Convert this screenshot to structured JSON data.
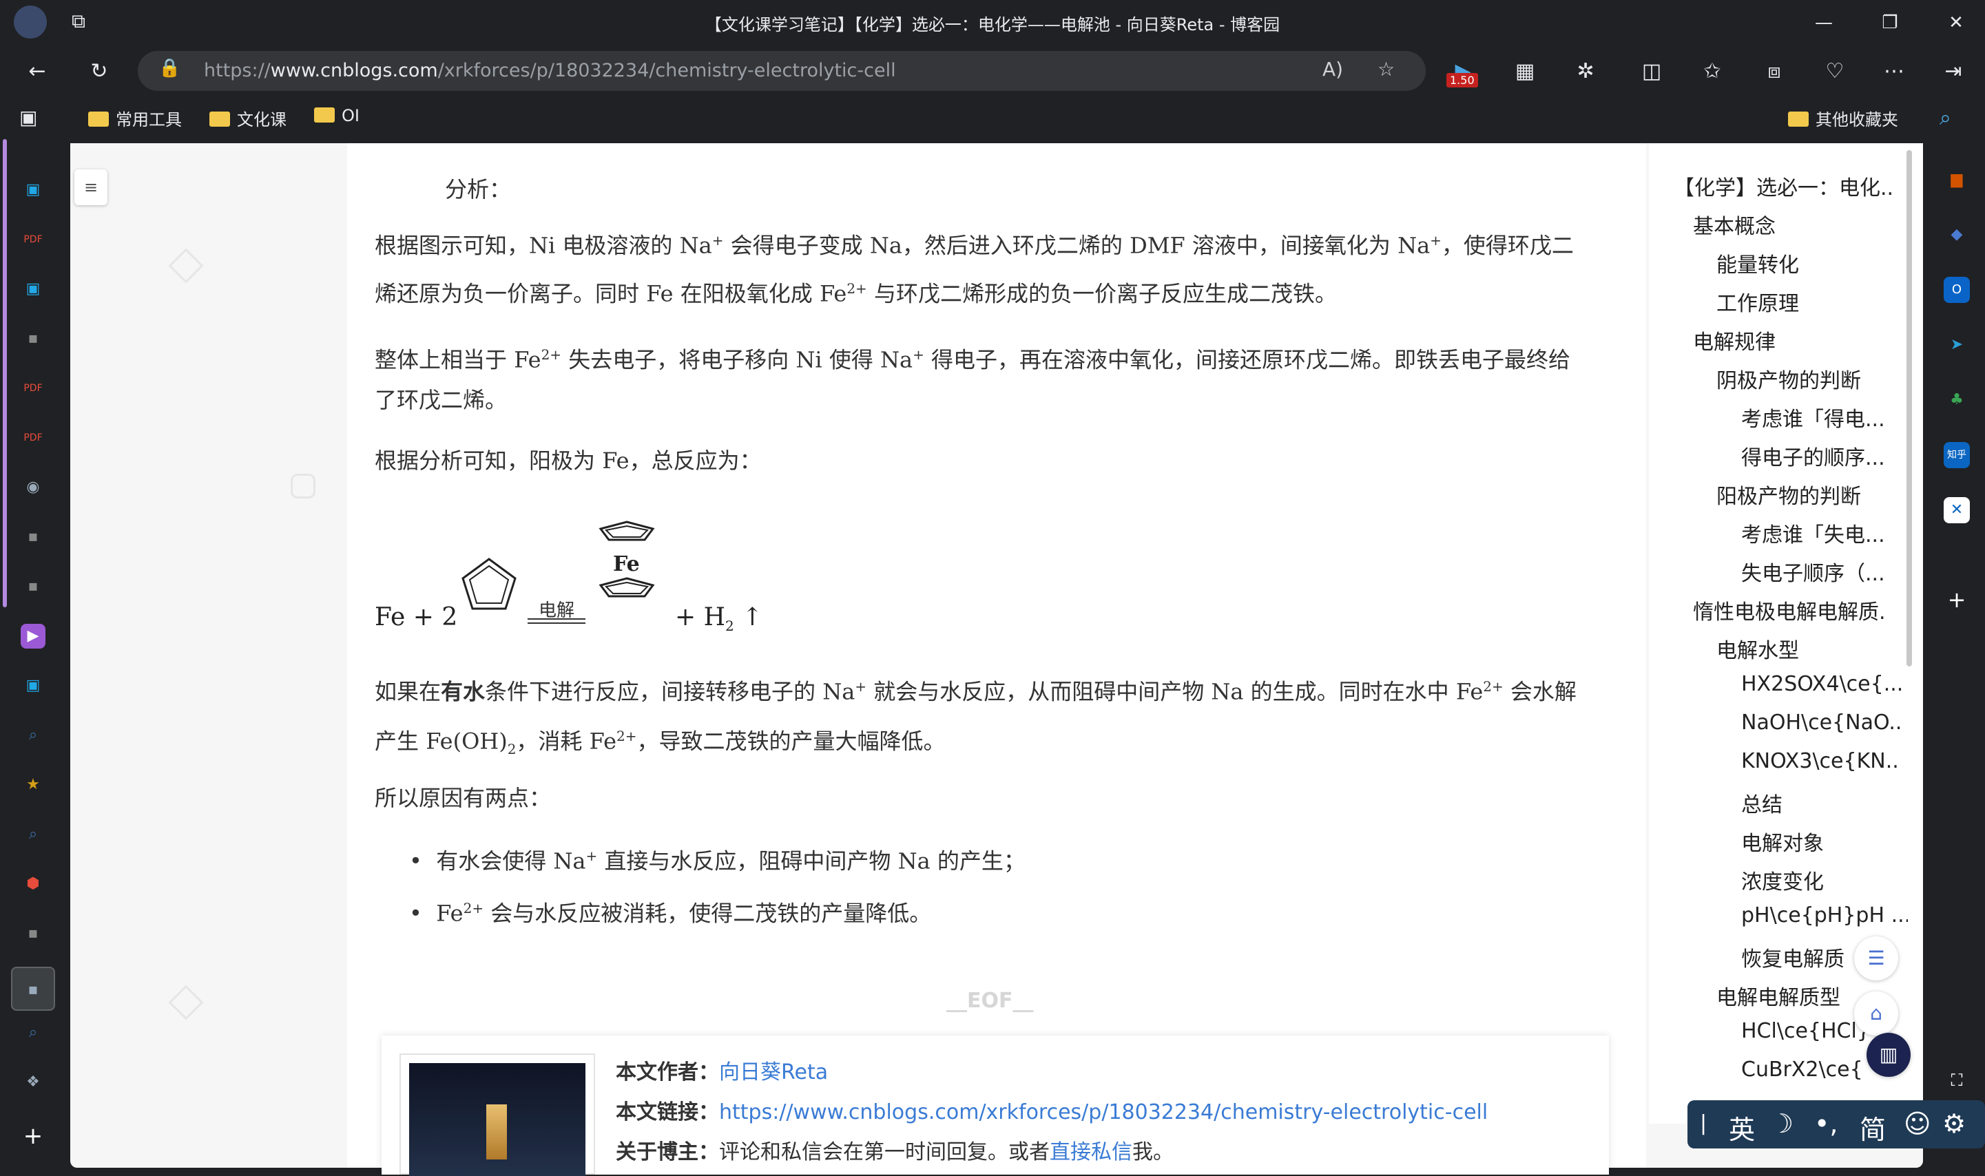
{
  "window": {
    "title": "【文化课学习笔记】【化学】选必一：电化学——电解池 - 向日葵Reta - 博客园"
  },
  "nav": {
    "url_prefix": "https://",
    "url_domain": "www.cnblogs.com",
    "url_path": "/xrkforces/p/18032234/chemistry-electrolytic-cell",
    "badge": "1.50"
  },
  "bookmarks": {
    "items": [
      {
        "label": "常用工具"
      },
      {
        "label": "文化课"
      },
      {
        "label": "OI"
      }
    ],
    "other": "其他收藏夹"
  },
  "article": {
    "p1": "分析：",
    "p2_a": "根据图示可知，",
    "p2_ni": "Ni",
    "p2_b": " 电极溶液的 ",
    "p2_na": "Na",
    "p2_c": " 会得电子变成 ",
    "p2_na2": "Na",
    "p2_d": "，然后进入环戊二烯的 ",
    "p2_dmf": "DMF",
    "p2_e": " 溶液中，间接氧化为 ",
    "p2_na3": "Na",
    "p2_f": "，使得环戊二",
    "p2_line2_a": "烯还原为负一价离子。同时 ",
    "p2_fe": "Fe",
    "p2_line2_b": " 在阳极氧化成 ",
    "p2_fe2": "Fe",
    "p2_line2_c": " 与环戊二烯形成的负一价离子反应生成二茂铁。",
    "p3_a": "整体上相当于 ",
    "p3_fe": "Fe",
    "p3_b": " 失去电子，将电子移向 ",
    "p3_ni": "Ni",
    "p3_c": " 使得 ",
    "p3_na": "Na",
    "p3_d": " 得电子，再在溶液中氧化，间接还原环戊二烯。即铁丢电子最终给",
    "p3_line2": "了环戊二烯。",
    "p4_a": "根据分析可知，阳极为 ",
    "p4_fe": "Fe",
    "p4_b": "，总反应为：",
    "eq_fe": "Fe + 2",
    "eq_cond": "电解",
    "eq_fe_label": "Fe",
    "eq_h2": "+ H",
    "eq_h2_sub": "2",
    "eq_arrow": "↑",
    "p5_a": "如果在",
    "p5_bold": "有水",
    "p5_b": "条件下进行反应，间接转移电子的 ",
    "p5_na": "Na",
    "p5_c": " 就会与水反应，从而阻碍中间产物 ",
    "p5_na2": "Na",
    "p5_d": " 的生成。同时在水中 ",
    "p5_fe": "Fe",
    "p5_e": " 会水解",
    "p5_line2_a": "产生 ",
    "p5_feoh": "Fe(OH)",
    "p5_feoh_sub": "2",
    "p5_line2_b": "，消耗 ",
    "p5_fe2": "Fe",
    "p5_line2_c": "，导致二茂铁的产量大幅降低。",
    "p6": "所以原因有两点：",
    "li1_a": "有水会使得 ",
    "li1_na": "Na",
    "li1_b": " 直接与水反应，阻碍中间产物 ",
    "li1_na2": "Na",
    "li1_c": " 的产生；",
    "li2_fe": "Fe",
    "li2_b": " 会与水反应被消耗，使得二茂铁的产量降低。",
    "sup_plus": "+",
    "sup_2plus": "2+",
    "eof": "__EOF__"
  },
  "author": {
    "author_label": "本文作者：",
    "author_name": "向日葵Reta",
    "link_label": "本文链接：",
    "link": "https://www.cnblogs.com/xrkforces/p/18032234/chemistry-electrolytic-cell",
    "about_label": "关于博主：",
    "about_a": "评论和私信会在第一时间回复。或者",
    "about_link": "直接私信",
    "about_b": "我。"
  },
  "toc": {
    "items": [
      {
        "label": "【化学】选必一：电化.."
      },
      {
        "label": "基本概念"
      },
      {
        "label": "能量转化"
      },
      {
        "label": "工作原理"
      },
      {
        "label": "电解规律"
      },
      {
        "label": "阴极产物的判断"
      },
      {
        "label": "考虑谁「得电..."
      },
      {
        "label": "得电子的顺序..."
      },
      {
        "label": "阳极产物的判断"
      },
      {
        "label": "考虑谁「失电..."
      },
      {
        "label": "失电子顺序（..."
      },
      {
        "label": "惰性电极电解电解质."
      },
      {
        "label": "电解水型"
      },
      {
        "label": "HX2SOX4\\ce{..."
      },
      {
        "label": "NaOH\\ce{NaO.."
      },
      {
        "label": "KNOX3\\ce{KN.."
      },
      {
        "label": "总结"
      },
      {
        "label": "电解对象"
      },
      {
        "label": "浓度变化"
      },
      {
        "label": "pH\\ce{pH}pH ..."
      },
      {
        "label": "恢复电解质"
      },
      {
        "label": "电解电解质型"
      },
      {
        "label": "HCl\\ce{HCl}"
      },
      {
        "label": "CuBrX2\\ce{"
      }
    ]
  },
  "ime": {
    "lang": "英",
    "mode": "简"
  }
}
